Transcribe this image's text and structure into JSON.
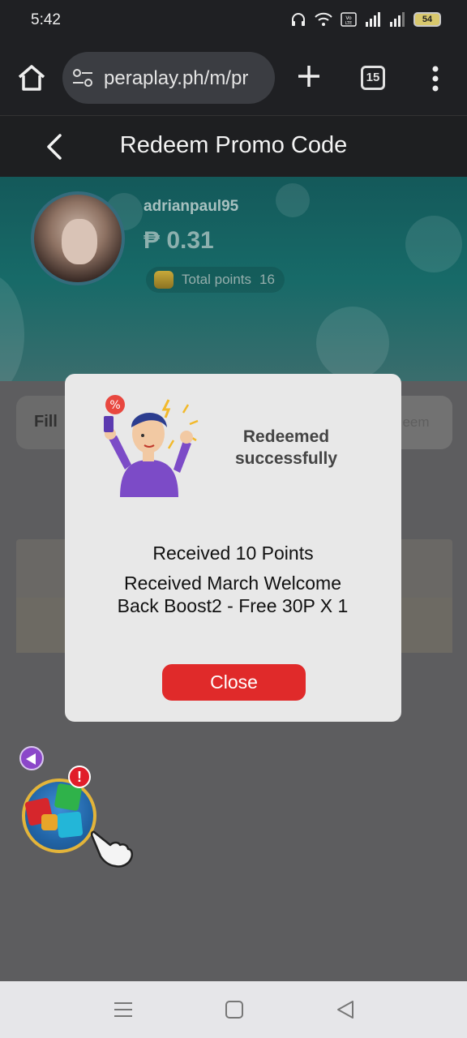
{
  "status_bar": {
    "time": "5:42",
    "battery": "54",
    "icons": [
      "headphones-icon",
      "wifi-icon",
      "volte-icon",
      "signal-icon",
      "signal-icon",
      "battery-icon"
    ]
  },
  "browser": {
    "url": "peraplay.ph/m/pr",
    "tab_count": "15",
    "icons": [
      "home-icon",
      "site-settings-icon",
      "plus-icon",
      "tabs-icon",
      "more-vert-icon"
    ]
  },
  "header": {
    "title": "Redeem Promo Code",
    "back_icon": "chevron-left-icon"
  },
  "profile": {
    "username": "adrianpaul95",
    "balance": "₱ 0.31",
    "points_label": "Total points",
    "points_value": "16"
  },
  "form": {
    "fill_label": "Fill",
    "redeem_label": "eem"
  },
  "modal": {
    "title": "Redeemed successfully",
    "message_1": "Received 10 Points",
    "message_2": "Received March Welcome Back Boost2 - Free 30P X 1",
    "close_label": "Close"
  },
  "widget": {
    "alert": "!"
  },
  "colors": {
    "accent_red": "#e02a2a",
    "header_bg": "#1e1f21",
    "profile_teal": "#176a68"
  }
}
